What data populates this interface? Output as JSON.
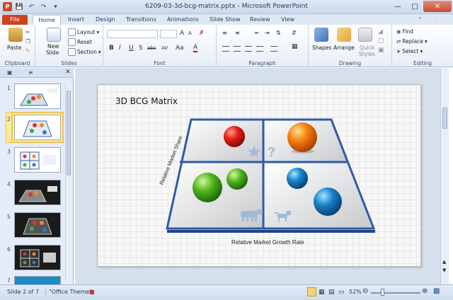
{
  "window": {
    "title": "6209-03-3d-bcg-matrix.pptx - Microsoft PowerPoint",
    "app_icon": "P"
  },
  "tabs": [
    "File",
    "Home",
    "Insert",
    "Design",
    "Transitions",
    "Animations",
    "Slide Show",
    "Review",
    "View"
  ],
  "ribbon": {
    "clipboard": {
      "label": "Clipboard",
      "paste": "Paste"
    },
    "slides": {
      "label": "Slides",
      "new_slide": "New",
      "new_slide2": "Slide",
      "layout": "Layout",
      "reset": "Reset",
      "section": "Section"
    },
    "font": {
      "label": "Font",
      "bold": "B",
      "italic": "I",
      "underline": "U",
      "shadow": "S",
      "strike": "abc",
      "spacing": "AV",
      "case": "Aa",
      "grow": "A",
      "shrink": "A"
    },
    "paragraph": {
      "label": "Paragraph"
    },
    "drawing": {
      "label": "Drawing",
      "shapes": "Shapes",
      "arrange": "Arrange",
      "quick_styles": "Quick",
      "quick_styles2": "Styles"
    },
    "editing": {
      "label": "Editing",
      "find": "Find",
      "replace": "Replace",
      "select": "Select"
    }
  },
  "thumbnails": {
    "numbers": [
      "1",
      "2",
      "3",
      "4",
      "5",
      "6",
      "7"
    ],
    "selected": "2"
  },
  "slide": {
    "title": "3D BCG Matrix",
    "y_axis": "Relative Market Share",
    "x_axis": "Relative Market Growth Rate"
  },
  "status": {
    "slide": "Slide 2 of 7",
    "theme": "\"Office Theme\"",
    "zoom": "52%"
  },
  "colors": {
    "file_tab": "#c9441f",
    "accent": "#2b579a",
    "matrix_border": "#2f5aa5"
  }
}
